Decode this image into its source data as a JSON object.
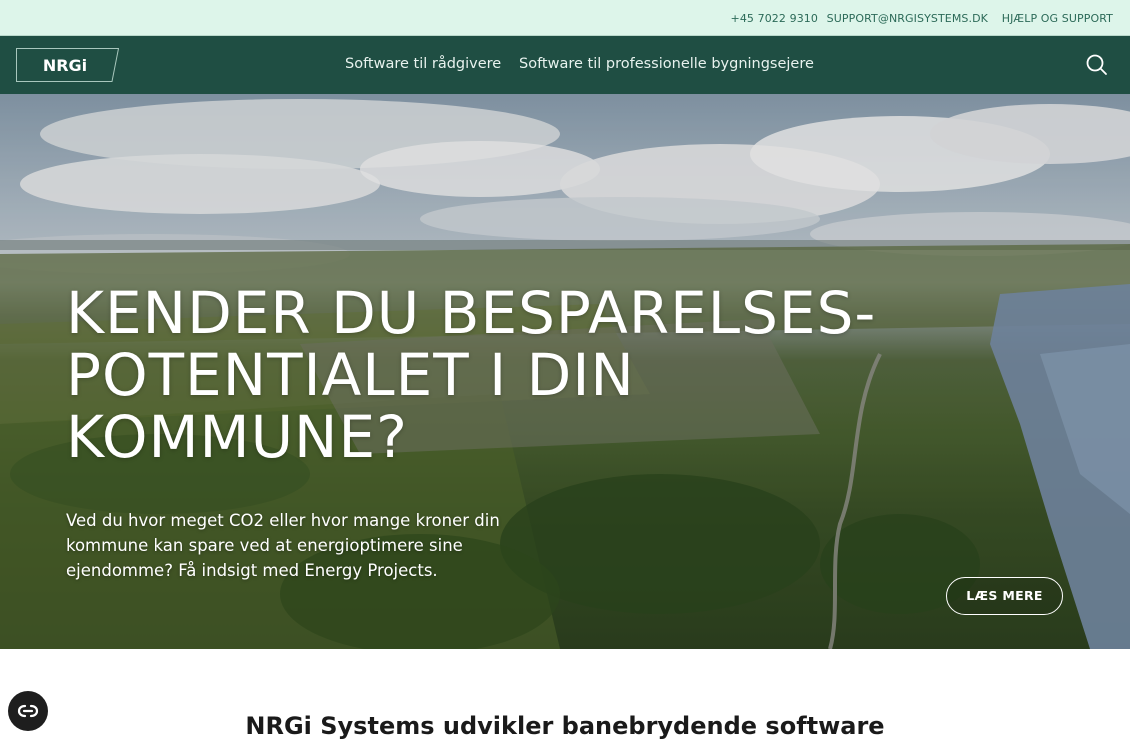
{
  "topbar": {
    "phone": "+45 7022 9310",
    "email": "SUPPORT@NRGISYSTEMS.DK",
    "help": "HJÆLP OG SUPPORT"
  },
  "navbar": {
    "logo_text": "NRGi",
    "links": [
      {
        "label": "Software til rådgivere"
      },
      {
        "label": "Software til professionelle bygningsejere"
      }
    ],
    "search_icon": "search-icon"
  },
  "hero": {
    "title_lines": [
      "KENDER DU BESPARELSES-",
      "POTENTIALET I DIN",
      "KOMMUNE?"
    ],
    "text": "Ved du hvor meget CO2 eller hvor mange kroner din kommune kan spare ved at energioptimere sine ejendomme? Få indsigt med Energy Projects.",
    "button_label": "LÆS MERE"
  },
  "intro": {
    "heading": "NRGi Systems udvikler banebrydende software"
  },
  "accessibility": {
    "icon": "accessibility-icon"
  },
  "colors": {
    "topbar_bg": "#ddf5ea",
    "topbar_text": "#2c6a58",
    "nav_bg": "#1f4e43",
    "nav_text": "#e7f2ee"
  }
}
